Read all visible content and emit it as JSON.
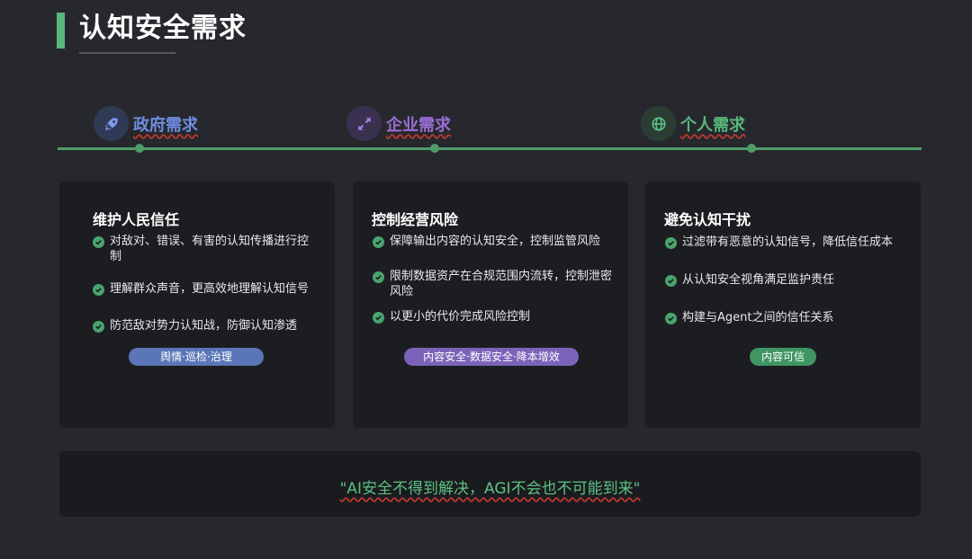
{
  "page_title": "认知安全需求",
  "categories": [
    {
      "label": "政府需求",
      "icon": "rocket-icon",
      "color": "#6f8ce0"
    },
    {
      "label": "企业需求",
      "icon": "expand-arrows-icon",
      "color": "#9a6fd6"
    },
    {
      "label": "个人需求",
      "icon": "globe-icon",
      "color": "#58b77c"
    }
  ],
  "cards": [
    {
      "title": "维护人民信任",
      "items": [
        "对敌对、错误、有害的认知传播进行控制",
        "理解群众声音，更高效地理解认知信号",
        "防范敌对势力认知战，防御认知渗透"
      ],
      "tag": "舆情·巡检·治理",
      "tag_color": "#5a76b8"
    },
    {
      "title": "控制经营风险",
      "items": [
        "保障输出内容的认知安全，控制监管风险",
        "限制数据资产在合规范围内流转，控制泄密风险",
        "以更小的代价完成风险控制"
      ],
      "tag": "内容安全·数据安全·降本增效",
      "tag_color": "#7c63ba"
    },
    {
      "title": "避免认知干扰",
      "items": [
        "过滤带有恶意的认知信号，降低信任成本",
        "从认知安全视角满足监护责任",
        "构建与Agent之间的信任关系"
      ],
      "tag": "内容可信",
      "tag_color": "#3f9563"
    }
  ],
  "quote": "\"AI安全不得到解决，AGI不会也不可能到来\""
}
